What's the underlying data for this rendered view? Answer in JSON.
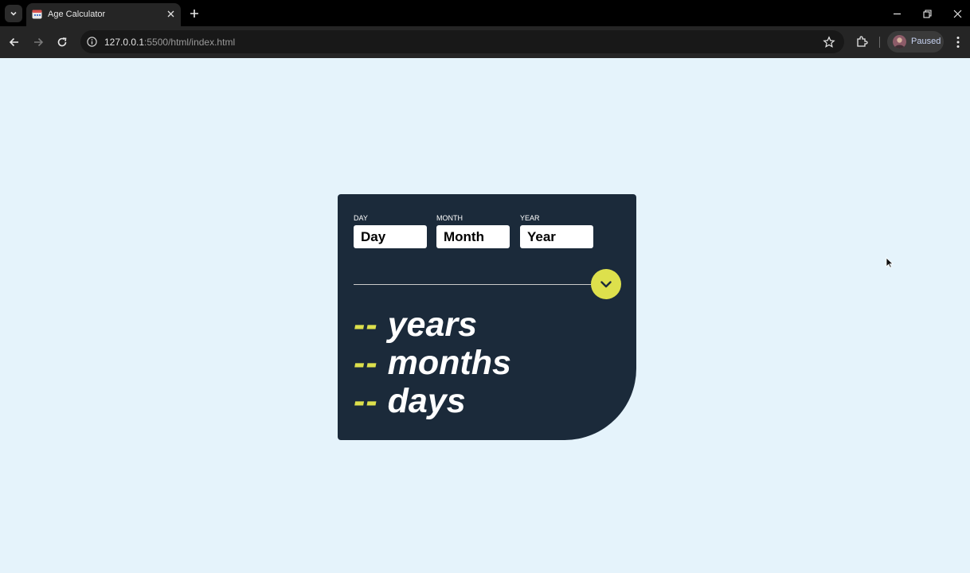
{
  "browser": {
    "tab_title": "Age Calculator",
    "url_host": "127.0.0.1",
    "url_rest": ":5500/html/index.html",
    "profile_label": "Paused"
  },
  "form": {
    "day": {
      "label": "DAY",
      "placeholder": "Day"
    },
    "month": {
      "label": "MONTH",
      "placeholder": "Month"
    },
    "year": {
      "label": "YEAR",
      "placeholder": "Year"
    }
  },
  "results": {
    "years": {
      "value": "--",
      "unit": "years"
    },
    "months": {
      "value": "--",
      "unit": "months"
    },
    "days": {
      "value": "--",
      "unit": "days"
    }
  },
  "colors": {
    "page_bg": "#e5f3fb",
    "card_bg": "#1b2a3a",
    "accent": "#dde04c"
  },
  "icons": {
    "submit": "chevron-down-icon",
    "tab_favicon": "calendar-icon"
  }
}
